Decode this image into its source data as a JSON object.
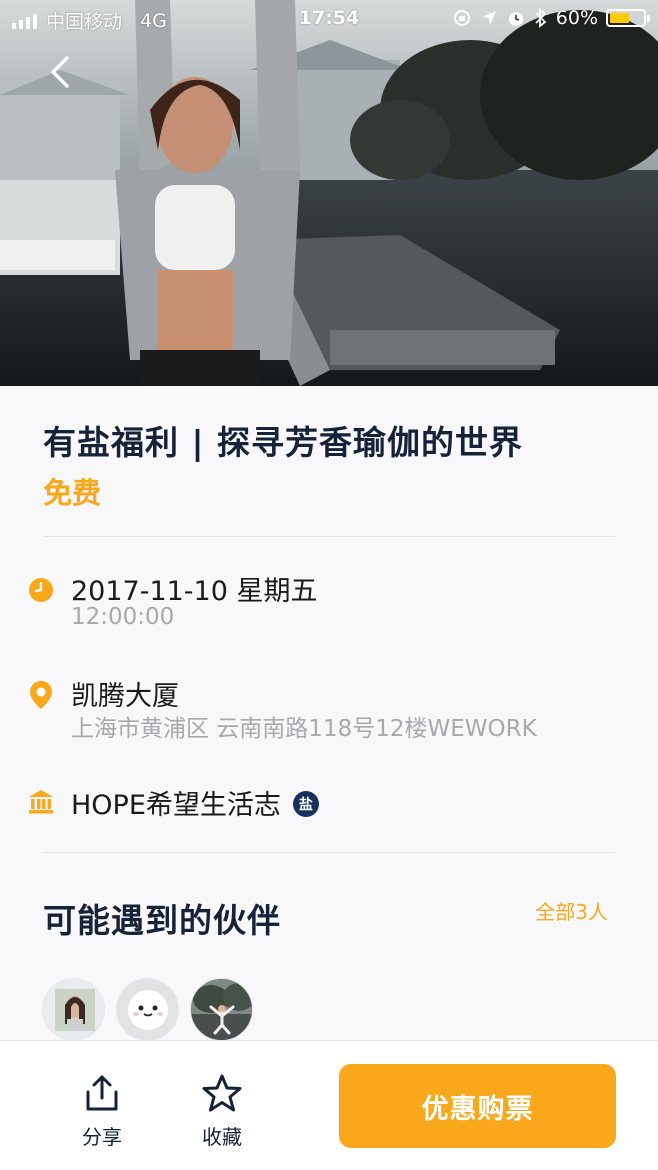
{
  "status_bar": {
    "carrier": "中国移动",
    "network": "4G",
    "time": "17:54",
    "battery_text": "60%",
    "battery_level": 0.6
  },
  "hero": {
    "image": "yoga-woman-stretching-on-pier-photo",
    "back_icon": "chevron-left-icon"
  },
  "event": {
    "title": "有盐福利 | 探寻芳香瑜伽的世界",
    "price": "免费",
    "date": "2017-11-10 星期五",
    "time": "12:00:00",
    "venue": "凯腾大厦",
    "address": "上海市黄浦区 云南南路118号12楼WEWORK",
    "organizer": "HOPE希望生活志",
    "organizer_badge": "盐"
  },
  "partners": {
    "title": "可能遇到的伙伴",
    "see_all": "全部3人",
    "avatars": [
      "woman-portrait-avatar",
      "cartoon-face-avatar",
      "yoga-pose-photo-avatar"
    ]
  },
  "bottom_bar": {
    "share_label": "分享",
    "favorite_label": "收藏",
    "buy_label": "优惠购票"
  },
  "colors": {
    "accent": "#f9a71b",
    "title": "#152238",
    "secondary_text": "#a8a8ad",
    "background": "#f8f8fb"
  }
}
